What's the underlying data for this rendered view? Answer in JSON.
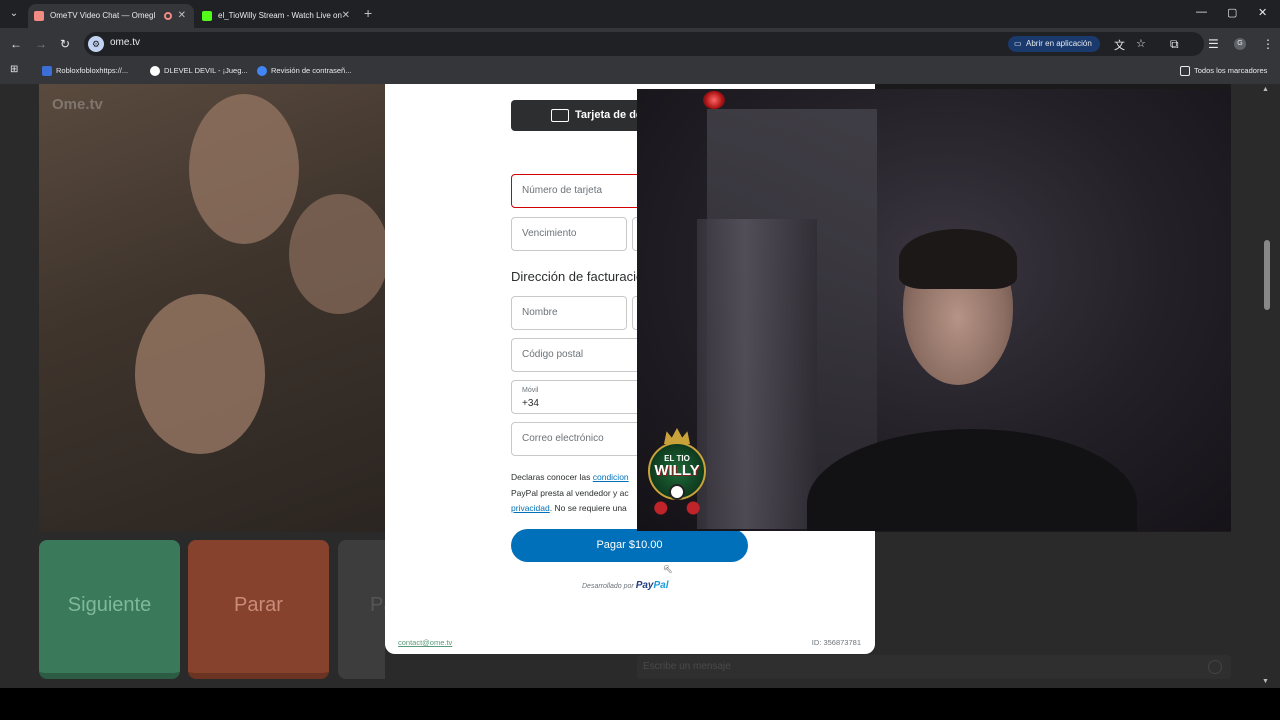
{
  "browser": {
    "tabs": [
      {
        "title": "OmeTV Video Chat — Omegl",
        "active": true,
        "favicon_color": "#f28b82",
        "recording": true
      },
      {
        "title": "el_TioWilly Stream - Watch Live on",
        "active": false,
        "favicon_color": "#53fc18"
      }
    ],
    "new_tab_label": "+",
    "window_controls": {
      "minimize": "—",
      "maximize": "▢",
      "close": "✕"
    },
    "url": "ome.tv",
    "open_in_app_label": "Abrir en aplicación",
    "bookmarks": [
      {
        "label": "Robloxfobloxhttps://...",
        "icon_color": "#3b6fd6"
      },
      {
        "label": "DLEVEL DEVIL - ¡Jueg...",
        "icon_color": "#ffffff"
      },
      {
        "label": "Revisión de contraseñ...",
        "icon_color": "#4285f4"
      }
    ],
    "all_bookmarks_label": "Todos los marcadores"
  },
  "ometv": {
    "logo_text": "Ome.tv",
    "next_button": "Siguiente",
    "stop_button": "Parar",
    "third_button": "Pa",
    "chat_placeholder": "Escribe un mensaje"
  },
  "payment": {
    "tab_label": "Tarjeta de de",
    "card_number_placeholder": "Número de tarjeta",
    "expiry_placeholder": "Vencimiento",
    "billing_title": "Dirección de facturació",
    "name_placeholder": "Nombre",
    "postal_placeholder": "Código postal",
    "phone_label": "Móvil",
    "phone_prefix": "+34",
    "email_placeholder": "Correo electrónico",
    "terms_line1_prefix": "Declaras conocer las ",
    "terms_link1": "condicion",
    "terms_line2": "PayPal presta al vendedor y ac",
    "terms_link2": "privacidad",
    "terms_line3_suffix": ". No se requiere una",
    "pay_button": "Pagar $10.00",
    "powered_by": "Desarrollado por",
    "paypal_pay": "Pay",
    "paypal_pal": "Pal",
    "contact_email": "contact@ome.tv",
    "reference_id": "ID: 356873781"
  },
  "stream_overlay": {
    "logo_top": "EL TIO",
    "logo_main": "WILLY"
  }
}
